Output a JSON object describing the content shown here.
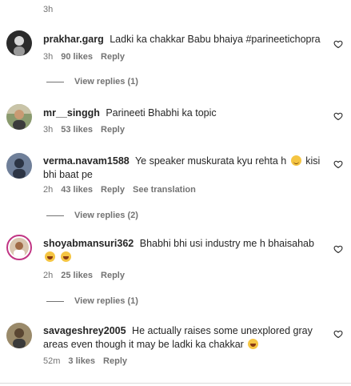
{
  "top_time": "3h",
  "comments": [
    {
      "user": "prakhar.garg",
      "text": "Ladki ka chakkar Babu bhaiya #parineetichopra",
      "time": "3h",
      "likes": "90 likes",
      "reply": "Reply",
      "view_replies": "View replies (1)"
    },
    {
      "user": "mr__singgh",
      "text": "Parineeti Bhabhi ka topic",
      "time": "3h",
      "likes": "53 likes",
      "reply": "Reply"
    },
    {
      "user": "verma.navam1588",
      "text_a": "Ye speaker muskurata kyu rehta h",
      "text_b": "kisi bhi baat pe",
      "time": "2h",
      "likes": "43 likes",
      "reply": "Reply",
      "translation": "See translation",
      "view_replies": "View replies (2)"
    },
    {
      "user": "shoyabmansuri362",
      "text": "Bhabhi bhi usi industry me h bhaisahab",
      "time": "2h",
      "likes": "25 likes",
      "reply": "Reply",
      "view_replies": "View replies (1)"
    },
    {
      "user": "savageshrey2005",
      "text": "He actually raises some unexplored gray areas even though it may be ladki ka chakkar",
      "time": "52m",
      "likes": "3 likes",
      "reply": "Reply"
    }
  ],
  "icons": {
    "like": "heart-outline-icon",
    "laugh": "laughing-emoji-icon",
    "smile": "smiling-emoji-icon"
  },
  "colors": {
    "text": "#262626",
    "secondary": "#737373",
    "story_ring": "#c13584"
  }
}
